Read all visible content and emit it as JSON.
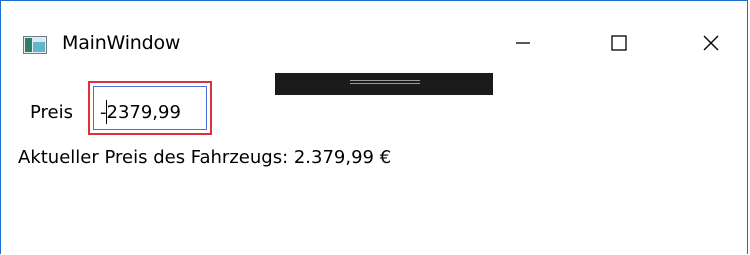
{
  "window": {
    "title": "MainWindow",
    "app_icon": "wpf-app-icon",
    "border_color": "#1a6fd0"
  },
  "controls": {
    "minimize_icon": "minimize-icon",
    "maximize_icon": "maximize-icon",
    "close_icon": "close-icon"
  },
  "debug_toolbar": {
    "icon": "debug-toolbar-grip-icon",
    "color": "#1b1b1b"
  },
  "form": {
    "price_label": "Preis",
    "price_value": "-2379,99",
    "price_border_color": "#e0303a",
    "current_price_text": "Aktueller Preis des Fahrzeugs: 2.379,99 €"
  }
}
